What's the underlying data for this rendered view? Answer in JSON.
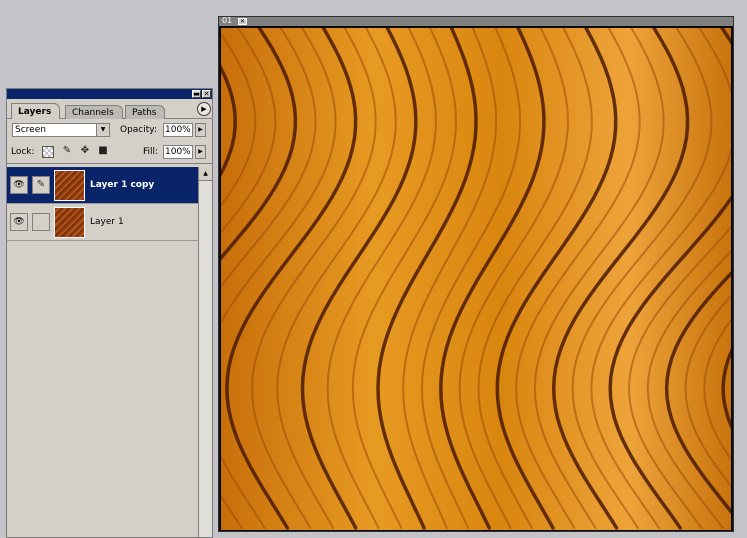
{
  "layers_panel": {
    "tabs": [
      {
        "label": "Layers",
        "active": true
      },
      {
        "label": "Channels",
        "active": false
      },
      {
        "label": "Paths",
        "active": false
      }
    ],
    "blend_mode": "Screen",
    "opacity_label": "Opacity:",
    "opacity_value": "100%",
    "lock_label": "Lock:",
    "fill_label": "Fill:",
    "fill_value": "100%",
    "layers": [
      {
        "name": "Layer 1 copy",
        "selected": true,
        "visible": true,
        "linked_brush": true
      },
      {
        "name": "Layer 1",
        "selected": false,
        "visible": true,
        "linked_brush": false
      }
    ]
  },
  "document": {
    "title": "01",
    "texture": "wood-grain",
    "colors": {
      "base": "#d9860f",
      "light": "#f0a63a",
      "dark": "#4a1a02",
      "mid": "#9a4a0a"
    }
  }
}
